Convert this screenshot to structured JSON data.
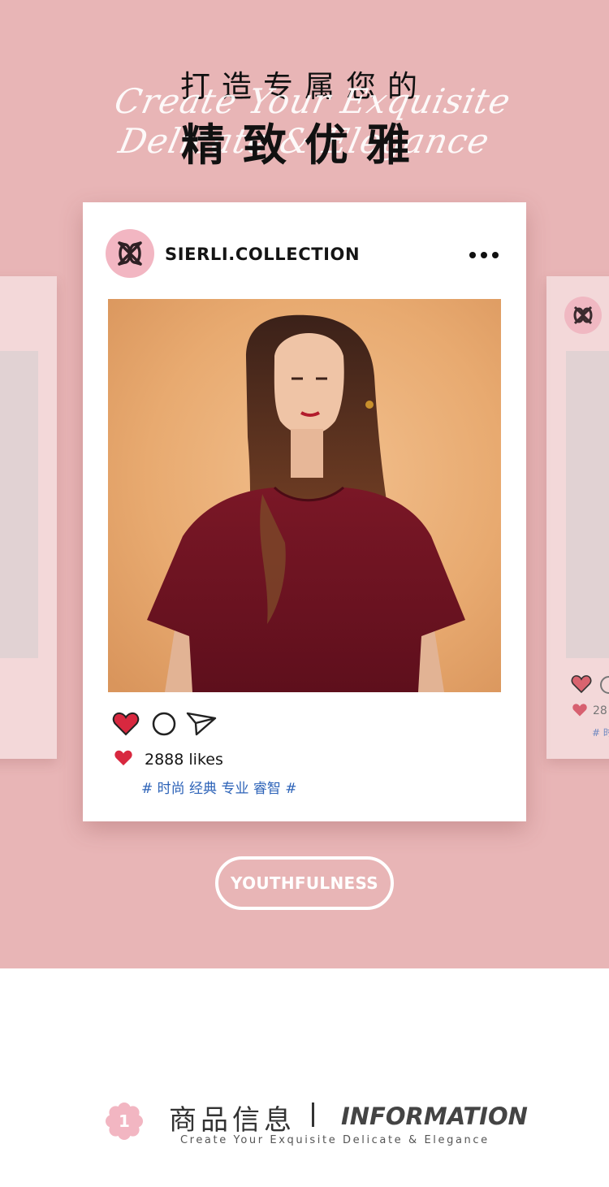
{
  "header": {
    "line_top": "打造专属您的",
    "script_line": "Create Your Exquisite Delicate & Elegance",
    "line_main": "精致优雅"
  },
  "post": {
    "username": "SIERLI.COLLECTION",
    "more_icon": "more-dots-icon",
    "likes_text": "2888 likes",
    "tags": "# 时尚 经典 专业 睿智 #",
    "icons": [
      "heart-icon",
      "comment-icon",
      "send-icon"
    ]
  },
  "side_cards": {
    "likes_partial": "28",
    "tag_partial": "# 时"
  },
  "pill": {
    "label": "YOUTHFULNESS"
  },
  "info": {
    "number": "1",
    "title_cn": "商品信息",
    "title_en": "INFORMATION",
    "subtitle": "Create Your Exquisite Delicate & Elegance"
  },
  "colors": {
    "hero_bg": "#e8b5b6",
    "accent_pink": "#f2b6c2",
    "heart_red": "#d8283f",
    "tag_blue": "#2d63b8",
    "burgundy": "#7c1725"
  }
}
